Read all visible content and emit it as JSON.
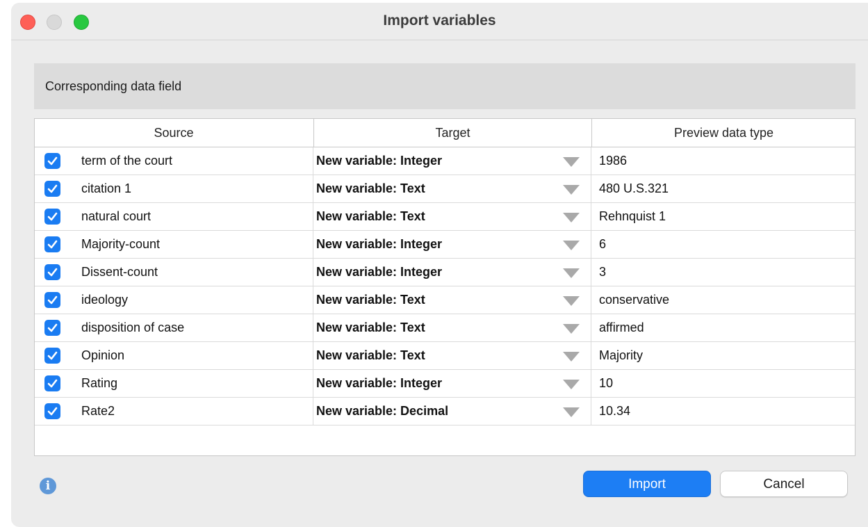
{
  "window": {
    "title": "Import variables"
  },
  "section": {
    "label": "Corresponding data field"
  },
  "table": {
    "headers": [
      "Source",
      "Target",
      "Preview data type"
    ],
    "rows": [
      {
        "checked": true,
        "source": "term of the court",
        "target": "New variable: Integer",
        "preview": "1986"
      },
      {
        "checked": true,
        "source": "citation 1",
        "target": "New variable: Text",
        "preview": "480 U.S.321"
      },
      {
        "checked": true,
        "source": "natural court",
        "target": "New variable: Text",
        "preview": "Rehnquist 1"
      },
      {
        "checked": true,
        "source": "Majority-count",
        "target": "New variable: Integer",
        "preview": "6"
      },
      {
        "checked": true,
        "source": "Dissent-count",
        "target": "New variable: Integer",
        "preview": "3"
      },
      {
        "checked": true,
        "source": "ideology",
        "target": "New variable: Text",
        "preview": "conservative"
      },
      {
        "checked": true,
        "source": "disposition of case",
        "target": "New variable: Text",
        "preview": "affirmed"
      },
      {
        "checked": true,
        "source": "Opinion",
        "target": "New variable: Text",
        "preview": "Majority"
      },
      {
        "checked": true,
        "source": "Rating",
        "target": "New variable: Integer",
        "preview": "10"
      },
      {
        "checked": true,
        "source": "Rate2",
        "target": "New variable: Decimal",
        "preview": "10.34"
      }
    ]
  },
  "buttons": {
    "import": "Import",
    "cancel": "Cancel"
  },
  "icons": {
    "close": "close-icon",
    "minimize": "minimize-icon",
    "maximize": "maximize-icon",
    "info": "info-icon",
    "checkbox": "checkmark-icon",
    "dropdown": "triangle-down-icon"
  },
  "colors": {
    "accent": "#1a7cf2",
    "close": "#fe5f57",
    "maximize": "#28c840",
    "minimize_inactive": "#d9d9d9"
  }
}
